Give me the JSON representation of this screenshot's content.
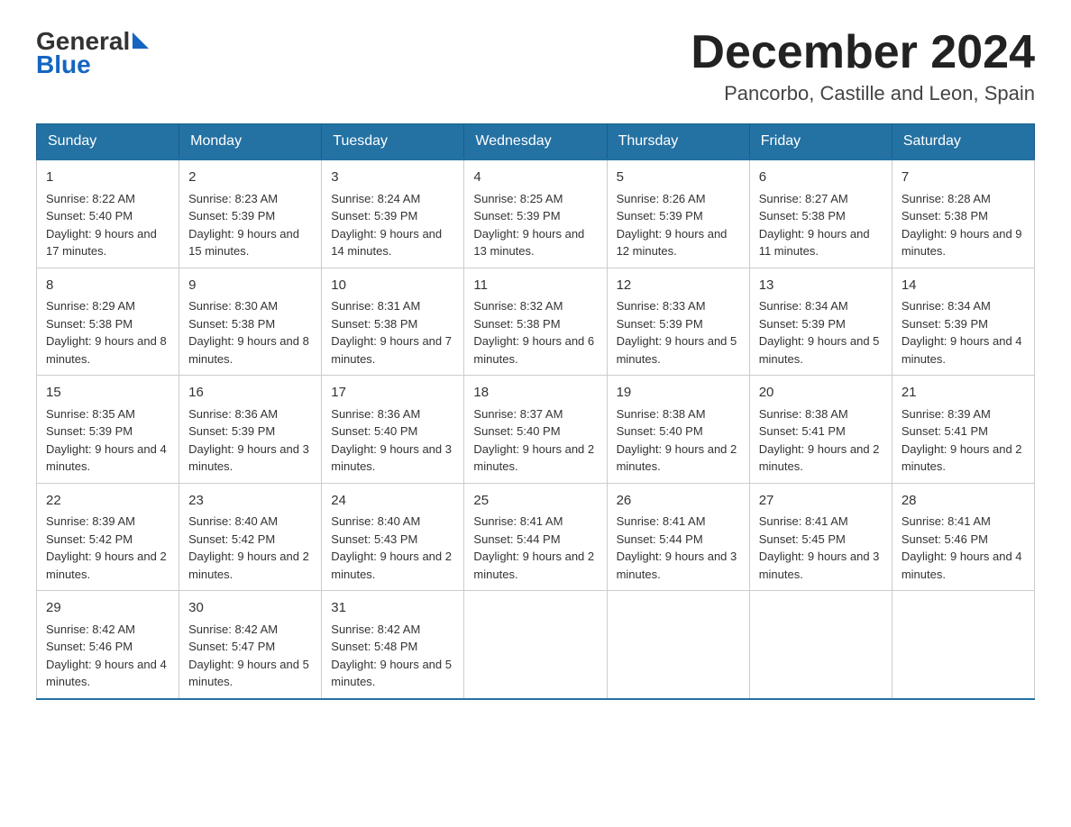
{
  "header": {
    "logo_general": "General",
    "logo_arrow": "▶",
    "logo_blue": "Blue",
    "month_title": "December 2024",
    "location": "Pancorbo, Castille and Leon, Spain"
  },
  "calendar": {
    "days_of_week": [
      "Sunday",
      "Monday",
      "Tuesday",
      "Wednesday",
      "Thursday",
      "Friday",
      "Saturday"
    ],
    "weeks": [
      [
        {
          "day": "1",
          "sunrise": "8:22 AM",
          "sunset": "5:40 PM",
          "daylight": "9 hours and 17 minutes."
        },
        {
          "day": "2",
          "sunrise": "8:23 AM",
          "sunset": "5:39 PM",
          "daylight": "9 hours and 15 minutes."
        },
        {
          "day": "3",
          "sunrise": "8:24 AM",
          "sunset": "5:39 PM",
          "daylight": "9 hours and 14 minutes."
        },
        {
          "day": "4",
          "sunrise": "8:25 AM",
          "sunset": "5:39 PM",
          "daylight": "9 hours and 13 minutes."
        },
        {
          "day": "5",
          "sunrise": "8:26 AM",
          "sunset": "5:39 PM",
          "daylight": "9 hours and 12 minutes."
        },
        {
          "day": "6",
          "sunrise": "8:27 AM",
          "sunset": "5:38 PM",
          "daylight": "9 hours and 11 minutes."
        },
        {
          "day": "7",
          "sunrise": "8:28 AM",
          "sunset": "5:38 PM",
          "daylight": "9 hours and 9 minutes."
        }
      ],
      [
        {
          "day": "8",
          "sunrise": "8:29 AM",
          "sunset": "5:38 PM",
          "daylight": "9 hours and 8 minutes."
        },
        {
          "day": "9",
          "sunrise": "8:30 AM",
          "sunset": "5:38 PM",
          "daylight": "9 hours and 8 minutes."
        },
        {
          "day": "10",
          "sunrise": "8:31 AM",
          "sunset": "5:38 PM",
          "daylight": "9 hours and 7 minutes."
        },
        {
          "day": "11",
          "sunrise": "8:32 AM",
          "sunset": "5:38 PM",
          "daylight": "9 hours and 6 minutes."
        },
        {
          "day": "12",
          "sunrise": "8:33 AM",
          "sunset": "5:39 PM",
          "daylight": "9 hours and 5 minutes."
        },
        {
          "day": "13",
          "sunrise": "8:34 AM",
          "sunset": "5:39 PM",
          "daylight": "9 hours and 5 minutes."
        },
        {
          "day": "14",
          "sunrise": "8:34 AM",
          "sunset": "5:39 PM",
          "daylight": "9 hours and 4 minutes."
        }
      ],
      [
        {
          "day": "15",
          "sunrise": "8:35 AM",
          "sunset": "5:39 PM",
          "daylight": "9 hours and 4 minutes."
        },
        {
          "day": "16",
          "sunrise": "8:36 AM",
          "sunset": "5:39 PM",
          "daylight": "9 hours and 3 minutes."
        },
        {
          "day": "17",
          "sunrise": "8:36 AM",
          "sunset": "5:40 PM",
          "daylight": "9 hours and 3 minutes."
        },
        {
          "day": "18",
          "sunrise": "8:37 AM",
          "sunset": "5:40 PM",
          "daylight": "9 hours and 2 minutes."
        },
        {
          "day": "19",
          "sunrise": "8:38 AM",
          "sunset": "5:40 PM",
          "daylight": "9 hours and 2 minutes."
        },
        {
          "day": "20",
          "sunrise": "8:38 AM",
          "sunset": "5:41 PM",
          "daylight": "9 hours and 2 minutes."
        },
        {
          "day": "21",
          "sunrise": "8:39 AM",
          "sunset": "5:41 PM",
          "daylight": "9 hours and 2 minutes."
        }
      ],
      [
        {
          "day": "22",
          "sunrise": "8:39 AM",
          "sunset": "5:42 PM",
          "daylight": "9 hours and 2 minutes."
        },
        {
          "day": "23",
          "sunrise": "8:40 AM",
          "sunset": "5:42 PM",
          "daylight": "9 hours and 2 minutes."
        },
        {
          "day": "24",
          "sunrise": "8:40 AM",
          "sunset": "5:43 PM",
          "daylight": "9 hours and 2 minutes."
        },
        {
          "day": "25",
          "sunrise": "8:41 AM",
          "sunset": "5:44 PM",
          "daylight": "9 hours and 2 minutes."
        },
        {
          "day": "26",
          "sunrise": "8:41 AM",
          "sunset": "5:44 PM",
          "daylight": "9 hours and 3 minutes."
        },
        {
          "day": "27",
          "sunrise": "8:41 AM",
          "sunset": "5:45 PM",
          "daylight": "9 hours and 3 minutes."
        },
        {
          "day": "28",
          "sunrise": "8:41 AM",
          "sunset": "5:46 PM",
          "daylight": "9 hours and 4 minutes."
        }
      ],
      [
        {
          "day": "29",
          "sunrise": "8:42 AM",
          "sunset": "5:46 PM",
          "daylight": "9 hours and 4 minutes."
        },
        {
          "day": "30",
          "sunrise": "8:42 AM",
          "sunset": "5:47 PM",
          "daylight": "9 hours and 5 minutes."
        },
        {
          "day": "31",
          "sunrise": "8:42 AM",
          "sunset": "5:48 PM",
          "daylight": "9 hours and 5 minutes."
        },
        null,
        null,
        null,
        null
      ]
    ]
  }
}
